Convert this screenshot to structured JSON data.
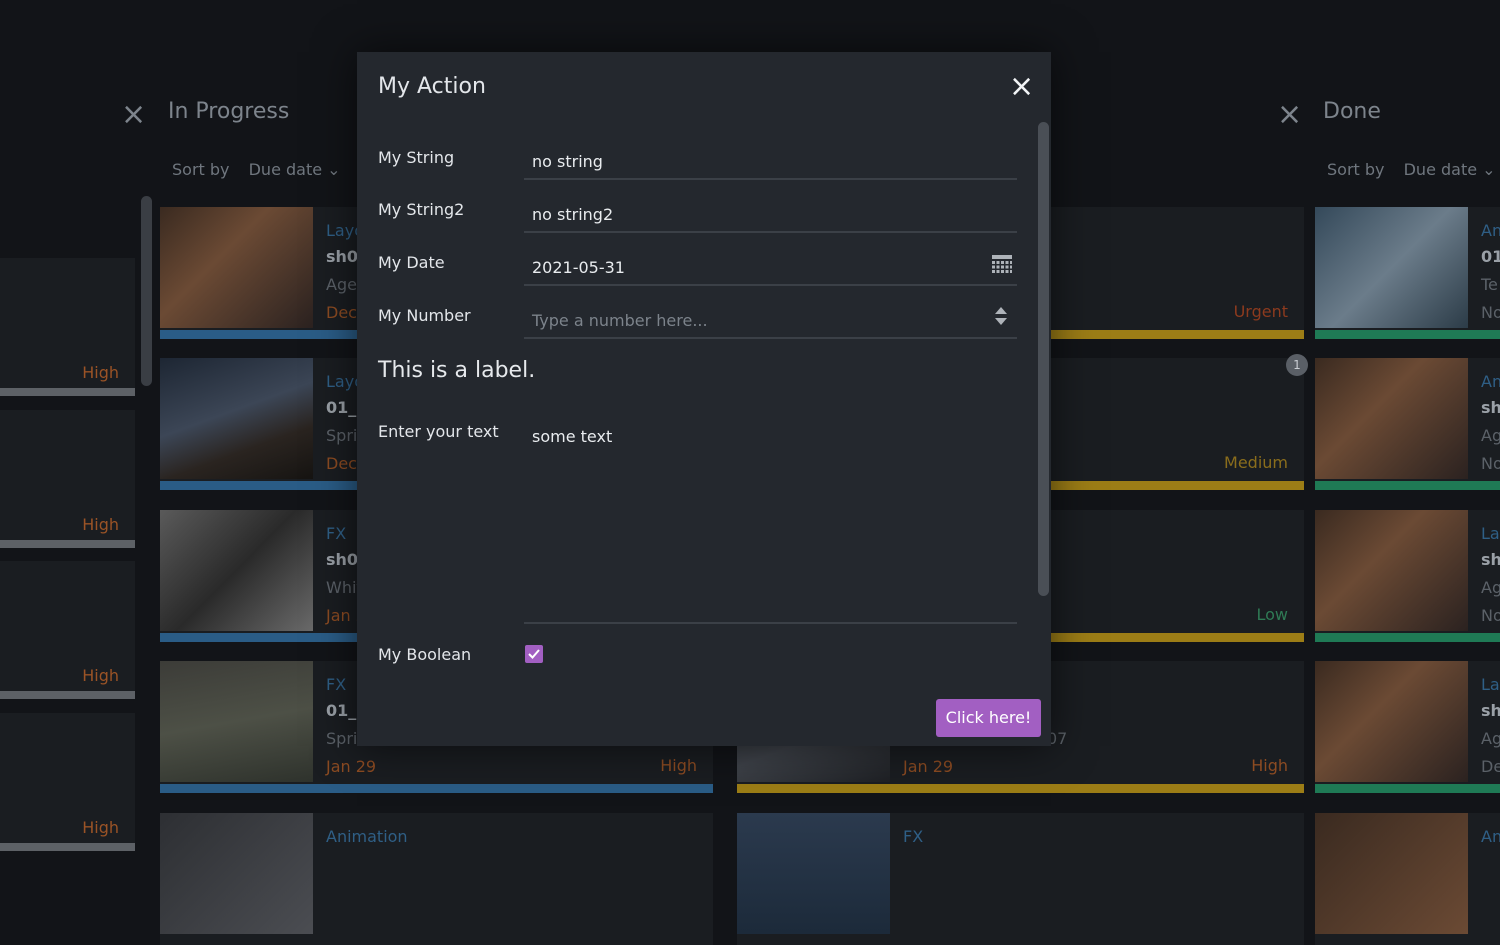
{
  "board": {
    "columns": [
      {
        "title": "In Progress",
        "sort_label": "Sort by",
        "sort_value": "Due date"
      },
      {
        "title": "Done",
        "sort_label": "Sort by",
        "sort_value": "Due date"
      }
    ],
    "left_tiles": [
      "High",
      "High",
      "High",
      "High"
    ],
    "cards_in_progress": [
      {
        "l1": "Layo",
        "l2": "sh00",
        "l3": "Agen",
        "l4": "Dec"
      },
      {
        "l1": "Layo",
        "l2": "01_0",
        "l3": "Spri",
        "l4": "Dec"
      },
      {
        "l1": "FX",
        "l2": "sh01",
        "l3": "Whit",
        "l4": "Jan 2"
      },
      {
        "l1": "FX",
        "l2": "01_0",
        "l3": "Sprin",
        "l4": "Jan 29",
        "prio": "High"
      },
      {
        "l1": "Animation",
        "l2": "",
        "l3": "",
        "l4": ""
      }
    ],
    "cards_middle": [
      {
        "prio": "Urgent"
      },
      {
        "prio": "Medium",
        "badge": "1"
      },
      {
        "prio": "Low"
      },
      {
        "l3": "07",
        "l4": "Jan 29",
        "prio": "High"
      },
      {
        "l1": "FX"
      }
    ],
    "cards_done": [
      {
        "l1": "An",
        "l2": "01",
        "l3": "Te",
        "l4": "No"
      },
      {
        "l1": "An",
        "l2": "sh",
        "l3": "Ag",
        "l4": "No"
      },
      {
        "l1": "La",
        "l2": "sh",
        "l3": "Ag",
        "l4": "No"
      },
      {
        "l1": "La",
        "l2": "sh",
        "l3": "Ag",
        "l4": "De"
      },
      {
        "l1": "An"
      }
    ],
    "colors": {
      "blue_bar": "#2a5c86",
      "yellow_bar": "#9c7d16",
      "green_bar": "#1f7a55",
      "gray_bar": "#5d6166"
    }
  },
  "modal": {
    "title": "My Action",
    "fields": [
      {
        "label": "My String",
        "value": "no string"
      },
      {
        "label": "My String2",
        "value": "no string2"
      },
      {
        "label": "My Date",
        "value": "2021-05-31"
      },
      {
        "label": "My Number",
        "placeholder": "Type a number here..."
      }
    ],
    "static_label": "This is a label.",
    "textarea": {
      "label": "Enter your text",
      "value": "some text"
    },
    "boolean": {
      "label": "My Boolean",
      "checked": true
    },
    "button": "Click here!",
    "accent": "#a25fc2"
  }
}
